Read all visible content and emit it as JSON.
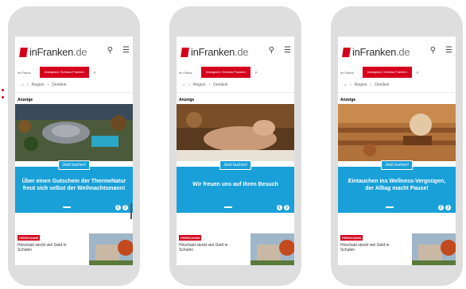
{
  "header": {
    "logo_text": "inFranken",
    "logo_tld": ".de"
  },
  "nav": {
    "item1": "Im Fokus",
    "highlight": "Instagram: Schloss Franken",
    "item3": "P"
  },
  "breadcrumb": {
    "sep": "›",
    "region": "Region",
    "place": "Dentlein"
  },
  "ad_label": "Anzeige",
  "phones": [
    {
      "cta_button": "Jetzt buchen!",
      "cta_text": "Über einen Gutschein der ThermeNatur freut sich selbst der Weihnachtsmann!"
    },
    {
      "cta_button": "Jetzt buchen!",
      "cta_text": "Wir freuen uns auf Ihren Besuch"
    },
    {
      "cta_button": "Jetzt buchen!",
      "cta_text": "Eintauchen ins Wellness-Vergnügen, der Alltag macht Pause!"
    }
  ],
  "news": {
    "tag": "FEIRSCHAID",
    "headline": "Hirschaid steckt viel Geld in Schulen"
  },
  "colors": {
    "brand": "#d6001c",
    "cta": "#1aa0d8",
    "frame": "#dedede"
  }
}
